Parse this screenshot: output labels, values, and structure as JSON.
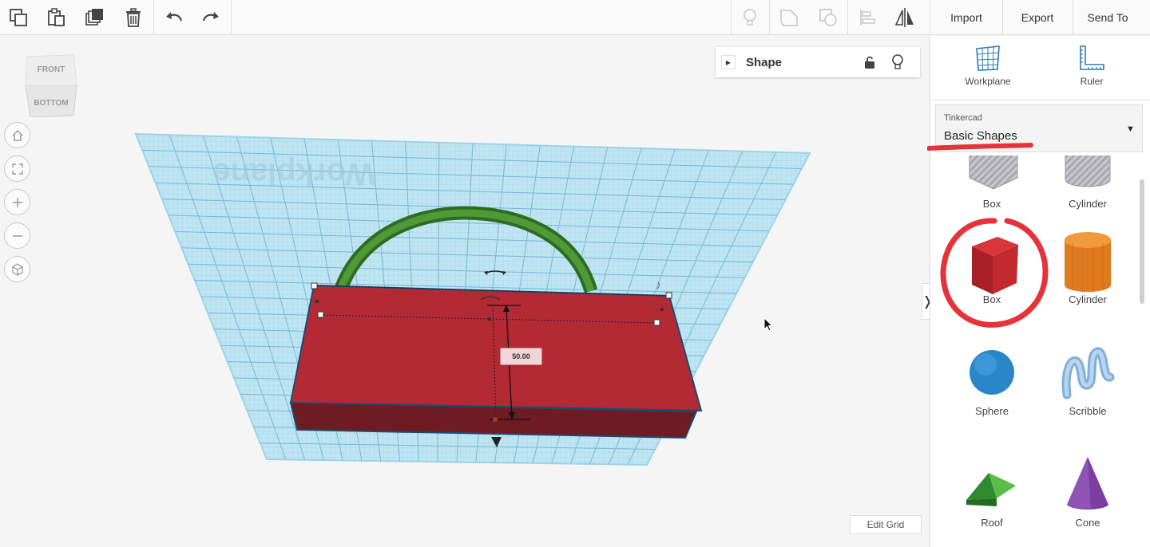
{
  "toolbar": {
    "icons": [
      "copy-icon",
      "paste-icon",
      "duplicate-icon",
      "delete-icon",
      "undo-icon",
      "redo-icon",
      "lightbulb-icon",
      "group-icon",
      "ungroup-icon",
      "align-icon",
      "mirror-icon"
    ],
    "import_label": "Import",
    "export_label": "Export",
    "send_to_label": "Send To"
  },
  "viewcube": {
    "front": "FRONT",
    "bottom": "BOTTOM"
  },
  "nav": {
    "icons": [
      "home-icon",
      "fit-view-icon",
      "zoom-in-icon",
      "zoom-out-icon",
      "perspective-icon"
    ]
  },
  "workplane": {
    "watermark": "Workplane"
  },
  "shape_panel": {
    "title": "Shape"
  },
  "dimension": {
    "value": "50.00"
  },
  "edit_grid_label": "Edit Grid",
  "right_panel": {
    "workplane_label": "Workplane",
    "ruler_label": "Ruler",
    "library": {
      "provider": "Tinkercad",
      "selected": "Basic Shapes"
    },
    "shapes": [
      {
        "label": "Box"
      },
      {
        "label": "Cylinder"
      },
      {
        "label": "Box"
      },
      {
        "label": "Cylinder"
      },
      {
        "label": "Sphere"
      },
      {
        "label": "Scribble"
      },
      {
        "label": "Roof"
      },
      {
        "label": "Cone"
      }
    ]
  },
  "colors": {
    "box_red": "#b32a35",
    "handle_green": "#3e7a2c",
    "workplane_blue": "#a9dcef",
    "annotation_red": "#e8323a"
  }
}
